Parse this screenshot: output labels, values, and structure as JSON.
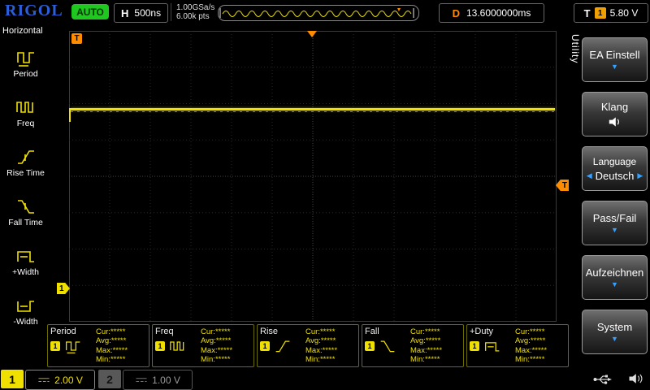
{
  "top_bar": {
    "brand": "RIGOL",
    "run_status": "AUTO",
    "h_label": "H",
    "timebase": "500ns",
    "sample_rate": "1.00GSa/s",
    "mem_depth": "6.00k pts",
    "d_label": "D",
    "delay": "13.6000000ms",
    "t_label": "T",
    "trig_source": "1",
    "trig_level": "5.80 V"
  },
  "left_sidebar": {
    "title": "Horizontal",
    "items": [
      {
        "label": "Period"
      },
      {
        "label": "Freq"
      },
      {
        "label": "Rise Time"
      },
      {
        "label": "Fall Time"
      },
      {
        "label": "+Width"
      },
      {
        "label": "-Width"
      }
    ]
  },
  "grid_markers": {
    "corner_flag": "T",
    "trigger_level_flag": "T",
    "channel1_flag": "1"
  },
  "right_menu": {
    "title": "Utility",
    "buttons": [
      {
        "label": "EA Einstell"
      },
      {
        "label": "Klang"
      },
      {
        "label": "Language",
        "value": "Deutsch"
      },
      {
        "label": "Pass/Fail"
      },
      {
        "label": "Aufzeichnen"
      },
      {
        "label": "System"
      }
    ]
  },
  "icons": {
    "down_arrow": "▼",
    "left_arrow": "◀",
    "right_arrow": "▶"
  },
  "measurements": {
    "labels": {
      "cur": "Cur:",
      "avg": "Avg:",
      "max": "Max:",
      "min": "Min:"
    },
    "items": [
      {
        "name": "Period",
        "channel": "1",
        "cur": "*****",
        "avg": "*****",
        "max": "*****",
        "min": "*****"
      },
      {
        "name": "Freq",
        "channel": "1",
        "cur": "*****",
        "avg": "*****",
        "max": "*****",
        "min": "*****"
      },
      {
        "name": "Rise",
        "channel": "1",
        "cur": "*****",
        "avg": "*****",
        "max": "*****",
        "min": "*****"
      },
      {
        "name": "Fall",
        "channel": "1",
        "cur": "*****",
        "avg": "*****",
        "max": "*****",
        "min": "*****"
      },
      {
        "name": "+Duty",
        "channel": "1",
        "cur": "*****",
        "avg": "*****",
        "max": "*****",
        "min": "*****"
      }
    ]
  },
  "bottom_bar": {
    "channels": [
      {
        "id": "1",
        "scale": "2.00 V"
      },
      {
        "id": "2",
        "scale": "1.00 V"
      }
    ]
  },
  "colors": {
    "trace_yellow": "#efe000",
    "trigger_orange": "#ff8c00",
    "menu_arrow_blue": "#35a2ff",
    "auto_green": "#1ec81e",
    "brand_blue": "#2b5fd9",
    "channel2_gray": "#9a9a9a"
  }
}
